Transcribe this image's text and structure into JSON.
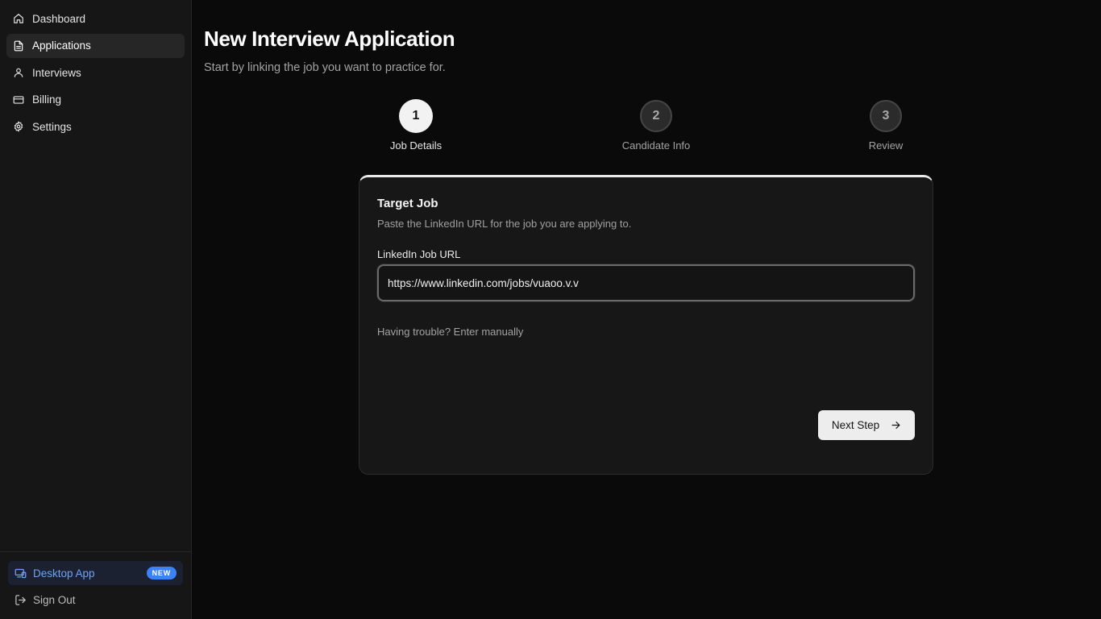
{
  "sidebar": {
    "items": [
      {
        "label": "Dashboard",
        "icon": "home-icon"
      },
      {
        "label": "Applications",
        "icon": "document-icon",
        "active": true
      },
      {
        "label": "Interviews",
        "icon": "user-icon"
      },
      {
        "label": "Billing",
        "icon": "credit-card-icon"
      },
      {
        "label": "Settings",
        "icon": "gear-icon"
      }
    ],
    "desktop_app": {
      "label": "Desktop App",
      "badge": "NEW",
      "icon": "devices-icon"
    },
    "sign_out": {
      "label": "Sign Out",
      "icon": "sign-out-icon"
    }
  },
  "page": {
    "title": "New Interview Application",
    "subtitle": "Start by linking the job you want to practice for."
  },
  "stepper": {
    "steps": [
      {
        "number": "1",
        "label": "Job Details",
        "state": "current"
      },
      {
        "number": "2",
        "label": "Candidate Info",
        "state": "pending"
      },
      {
        "number": "3",
        "label": "Review",
        "state": "pending"
      }
    ]
  },
  "card": {
    "title": "Target Job",
    "description": "Paste the LinkedIn URL for the job you are applying to.",
    "field_label": "LinkedIn Job URL",
    "url_value": "https://www.linkedin.com/jobs/vuaoo.v.v",
    "manual_link": "Having trouble? Enter manually",
    "next_button": "Next Step"
  },
  "colors": {
    "background": "#0a0a0a",
    "sidebar": "#161616",
    "accent_blue": "#3b82f6",
    "card": "#171717"
  }
}
